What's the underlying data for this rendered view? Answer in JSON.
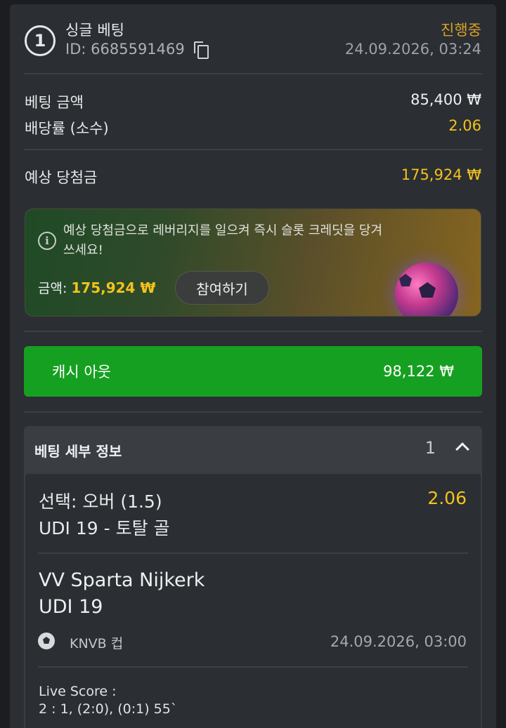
{
  "header": {
    "bet_number": "1",
    "bet_type": "싱글 베팅",
    "id_label": "ID:",
    "id_value": "6685591469",
    "status": "진행중",
    "datetime": "24.09.2026, 03:24"
  },
  "summary": {
    "stake_label": "베팅 금액",
    "stake_value": "85,400 ₩",
    "odds_label": "배당률 (소수)",
    "odds_value": "2.06",
    "payout_label": "예상 당첨금",
    "payout_value": "175,924 ₩"
  },
  "promo": {
    "text": "예상 당첨금으로 레버리지를 일으켜 즉시 슬롯 크레딧을 당겨 쓰세요!",
    "amount_label": "금액:",
    "amount_value": "175,924 ₩",
    "join_label": "참여하기"
  },
  "cashout": {
    "label": "캐시 아웃",
    "value": "98,122 ₩"
  },
  "details": {
    "title": "베팅 세부 정보",
    "count": "1",
    "selection": "선택: 오버 (1.5)",
    "selection_odds": "2.06",
    "market": "UDI 19 - 토탈 골",
    "home_team": "VV Sparta Nijkerk",
    "away_team": "UDI 19",
    "league": "KNVB 컵",
    "match_time": "24.09.2026, 03:00",
    "live_score_label": "Live Score :",
    "live_score_value": "2 : 1, (2:0), (0:1) 55`"
  },
  "colors": {
    "accent_gold": "#f3c21d",
    "status_orange": "#d9a22b",
    "cashout_green": "#16a021"
  }
}
